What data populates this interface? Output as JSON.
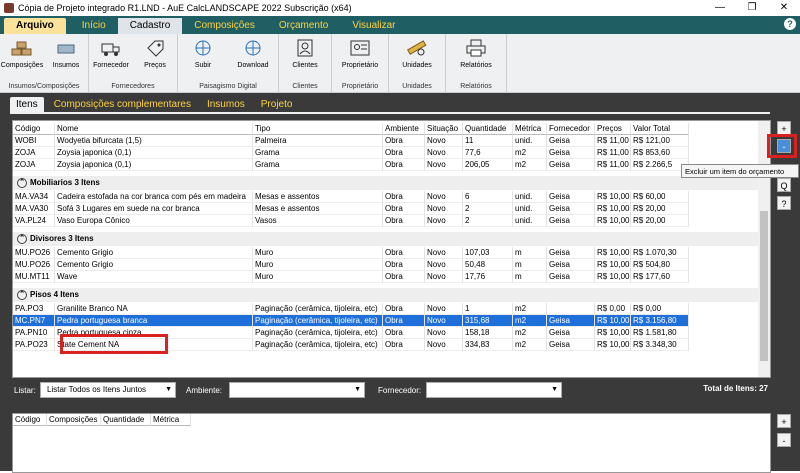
{
  "window": {
    "title": "Cópia de Projeto integrado R1.LND - AuE CalcLANDSCAPE 2022 Subscrição (x64)"
  },
  "ribbon_tabs": [
    {
      "label": "Arquivo"
    },
    {
      "label": "Início"
    },
    {
      "label": "Cadastro"
    },
    {
      "label": "Composições"
    },
    {
      "label": "Orçamento"
    },
    {
      "label": "Visualizar"
    }
  ],
  "ribbon_groups": [
    {
      "name": "Insumos/Composições",
      "buttons": [
        {
          "label": "Composições",
          "icon": "bricks-icon"
        },
        {
          "label": "Insumos",
          "icon": "brick-icon"
        }
      ]
    },
    {
      "name": "Fornecedores",
      "buttons": [
        {
          "label": "Fornecedor",
          "icon": "truck-icon"
        },
        {
          "label": "Preços",
          "icon": "price-tag-icon"
        }
      ]
    },
    {
      "name": "Paisagismo Digital",
      "buttons": [
        {
          "label": "Subir",
          "icon": "upload-globe-icon"
        },
        {
          "label": "Download",
          "icon": "download-globe-icon"
        }
      ]
    },
    {
      "name": "Clientes",
      "buttons": [
        {
          "label": "Clientes",
          "icon": "client-card-icon"
        }
      ]
    },
    {
      "name": "Proprietário",
      "buttons": [
        {
          "label": "Proprietário",
          "icon": "owner-card-icon"
        }
      ]
    },
    {
      "name": "Unidades",
      "buttons": [
        {
          "label": "Unidades",
          "icon": "ruler-gear-icon"
        }
      ]
    },
    {
      "name": "Relatórios",
      "buttons": [
        {
          "label": "Relatórios",
          "icon": "printer-icon"
        }
      ]
    }
  ],
  "sub_tabs": [
    {
      "label": "Itens"
    },
    {
      "label": "Composições complementares"
    },
    {
      "label": "Insumos"
    },
    {
      "label": "Projeto"
    }
  ],
  "table": {
    "columns": [
      "Código",
      "Nome",
      "Tipo",
      "Ambiente",
      "Situação",
      "Quantidade",
      "Métrica",
      "Fornecedor",
      "Preços",
      "Valor Total"
    ],
    "groups": [
      {
        "title": null,
        "rows": [
          [
            "WOBI",
            "Wodyetia bifurcata (1,5)",
            "Palmeira",
            "Obra",
            "Novo",
            "11",
            "unid.",
            "Geisa",
            "R$ 11,00",
            "R$ 121,00"
          ],
          [
            "ZOJA",
            "Zoysia japonica (0,1)",
            "Grama",
            "Obra",
            "Novo",
            "77,6",
            "m2",
            "Geisa",
            "R$ 11,00",
            "R$ 853,60"
          ],
          [
            "ZOJA",
            "Zoysia japonica (0,1)",
            "Grama",
            "Obra",
            "Novo",
            "206,05",
            "m2",
            "Geisa",
            "R$ 11,00",
            "R$ 2.266,5"
          ]
        ]
      },
      {
        "title": "Mobiliarios  3 Itens",
        "rows": [
          [
            "MA.VA34",
            "Cadeira estofada na cor branca com pés em madeira",
            "Mesas e assentos",
            "Obra",
            "Novo",
            "6",
            "unid.",
            "Geisa",
            "R$ 10,00",
            "R$ 60,00"
          ],
          [
            "MA.VA30",
            "Sofá 3 Lugares em suede na cor branca",
            "Mesas e assentos",
            "Obra",
            "Novo",
            "2",
            "unid.",
            "Geisa",
            "R$ 10,00",
            "R$ 20,00"
          ],
          [
            "VA.PL24",
            "Vaso Europa Cônico",
            "Vasos",
            "Obra",
            "Novo",
            "2",
            "unid.",
            "Geisa",
            "R$ 10,00",
            "R$ 20,00"
          ]
        ]
      },
      {
        "title": "Divisores  3 Itens",
        "rows": [
          [
            "MU.PO26",
            "Cemento Grigio",
            "Muro",
            "Obra",
            "Novo",
            "107,03",
            "m",
            "Geisa",
            "R$ 10,00",
            "R$ 1.070,30"
          ],
          [
            "MU.PO26",
            "Cemento Grigio",
            "Muro",
            "Obra",
            "Novo",
            "50,48",
            "m",
            "Geisa",
            "R$ 10,00",
            "R$ 504,80"
          ],
          [
            "MU.MT11",
            "Wave",
            "Muro",
            "Obra",
            "Novo",
            "17,76",
            "m",
            "Geisa",
            "R$ 10,00",
            "R$ 177,60"
          ]
        ]
      },
      {
        "title": "Pisos  4 Itens",
        "rows": [
          [
            "PA.PO3",
            "Granilite Branco NA",
            "Paginação (cerâmica, tijoleira, etc)",
            "Obra",
            "Novo",
            "1",
            "m2",
            "",
            "R$ 0,00",
            "R$ 0,00"
          ],
          [
            "MC.PN7",
            "Pedra portuguesa branca",
            "Paginação (cerâmica, tijoleira, etc)",
            "Obra",
            "Novo",
            "315,68",
            "m2",
            "Geisa",
            "R$ 10,00",
            "R$ 3.156,80"
          ],
          [
            "PA.PN10",
            "Pedra portuguesa cinza",
            "Paginação (cerâmica, tijoleira, etc)",
            "Obra",
            "Novo",
            "158,18",
            "m2",
            "Geisa",
            "R$ 10,00",
            "R$ 1.581,80"
          ],
          [
            "PA.PO23",
            "State Cement NA",
            "Paginação (cerâmica, tijoleira, etc)",
            "Obra",
            "Novo",
            "334,83",
            "m2",
            "Geisa",
            "R$ 10,00",
            "R$ 3.348,30"
          ]
        ]
      }
    ]
  },
  "side_buttons": [
    "+",
    "-",
    "Q",
    "?"
  ],
  "tooltip": "Excluir um item do orçamento",
  "filters": {
    "listar_label": "Listar:",
    "listar_value": "Listar Todos os Itens Juntos",
    "ambiente_label": "Ambiente:",
    "ambiente_value": "",
    "fornecedor_label": "Fornecedor:",
    "fornecedor_value": "",
    "total_label": "Total de Itens: 27"
  },
  "bottom_table": {
    "columns": [
      "Código",
      "Composições",
      "Quantidade",
      "Métrica"
    ]
  },
  "bottom_side_buttons": [
    "+",
    "-"
  ],
  "colors": {
    "teal": "#1f5f63",
    "accent_yellow": "#ffd23f",
    "selection": "#1e6fd9",
    "highlight_red": "#d9211f"
  }
}
